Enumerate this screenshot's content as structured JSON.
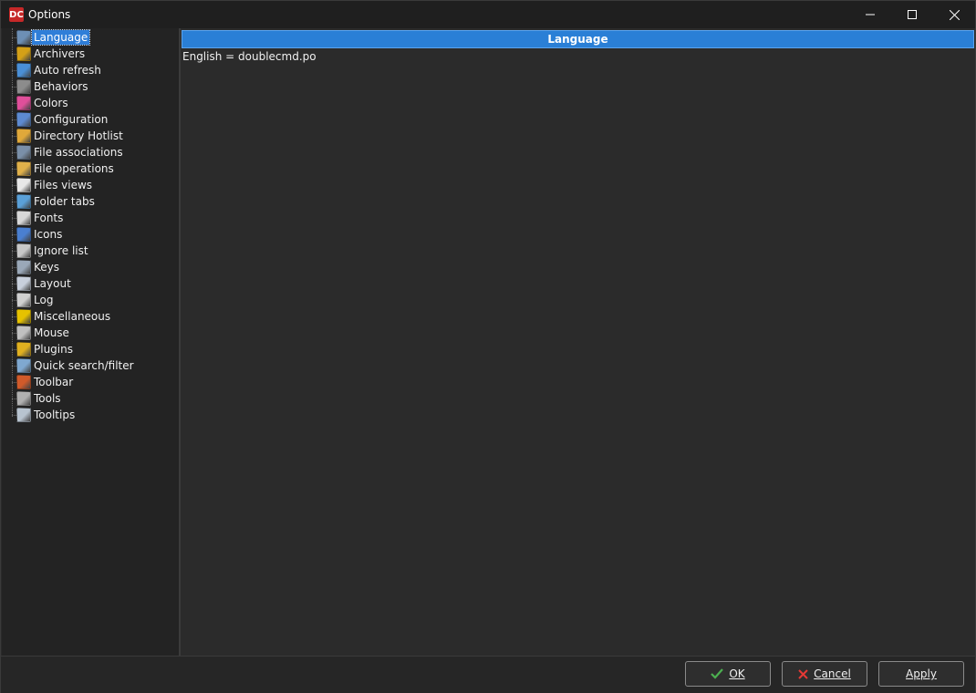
{
  "window": {
    "title": "Options",
    "app_icon_text": "DC",
    "controls": [
      "minimize-icon",
      "maximize-icon",
      "close-icon"
    ]
  },
  "sidebar": {
    "items": [
      {
        "label": "Language",
        "icon": "language-flag-icon",
        "color": "#6d8fb5",
        "selected": true
      },
      {
        "label": "Archivers",
        "icon": "archive-icon",
        "color": "#d4a017"
      },
      {
        "label": "Auto refresh",
        "icon": "refresh-icon",
        "color": "#4a8fd6"
      },
      {
        "label": "Behaviors",
        "icon": "lock-icon",
        "color": "#8c8c8c"
      },
      {
        "label": "Colors",
        "icon": "color-wheel-icon",
        "color": "#e04f9a"
      },
      {
        "label": "Configuration",
        "icon": "config-window-icon",
        "color": "#5d8ad0"
      },
      {
        "label": "Directory Hotlist",
        "icon": "folder-star-icon",
        "color": "#e0a83a"
      },
      {
        "label": "File associations",
        "icon": "file-list-icon",
        "color": "#7a8fa8"
      },
      {
        "label": "File operations",
        "icon": "folder-file-icon",
        "color": "#e0b04a"
      },
      {
        "label": "Files views",
        "icon": "columns-icon",
        "color": "#e8e8e8"
      },
      {
        "label": "Folder tabs",
        "icon": "tabs-icon",
        "color": "#5aa0d8"
      },
      {
        "label": "Fonts",
        "icon": "font-icon",
        "color": "#d8d8d8"
      },
      {
        "label": "Icons",
        "icon": "icons-icon",
        "color": "#4a7fd0"
      },
      {
        "label": "Ignore list",
        "icon": "ignore-list-icon",
        "color": "#c8c8c8"
      },
      {
        "label": "Keys",
        "icon": "keyboard-icon",
        "color": "#9aa8b8"
      },
      {
        "label": "Layout",
        "icon": "layout-icon",
        "color": "#c8d0dc"
      },
      {
        "label": "Log",
        "icon": "log-icon",
        "color": "#d0d0d0"
      },
      {
        "label": "Miscellaneous",
        "icon": "misc-smiley-icon",
        "color": "#e6c200"
      },
      {
        "label": "Mouse",
        "icon": "mouse-icon",
        "color": "#c0c0c0"
      },
      {
        "label": "Plugins",
        "icon": "puzzle-icon",
        "color": "#e0b020"
      },
      {
        "label": "Quick search/filter",
        "icon": "search-file-icon",
        "color": "#7fa8d0"
      },
      {
        "label": "Toolbar",
        "icon": "toolbar-icon",
        "color": "#d05a2a"
      },
      {
        "label": "Tools",
        "icon": "tools-icon",
        "color": "#b0b0b0"
      },
      {
        "label": "Tooltips",
        "icon": "lightbulb-icon",
        "color": "#b8c4d0"
      }
    ]
  },
  "content": {
    "header": "Language",
    "entry": "English = doublecmd.po"
  },
  "buttons": {
    "ok": {
      "label": "OK",
      "icon": "check-icon",
      "icon_color": "#4caf50"
    },
    "cancel": {
      "label": "Cancel",
      "icon": "x-icon",
      "icon_color": "#e53935"
    },
    "apply": {
      "label": "Apply"
    }
  }
}
